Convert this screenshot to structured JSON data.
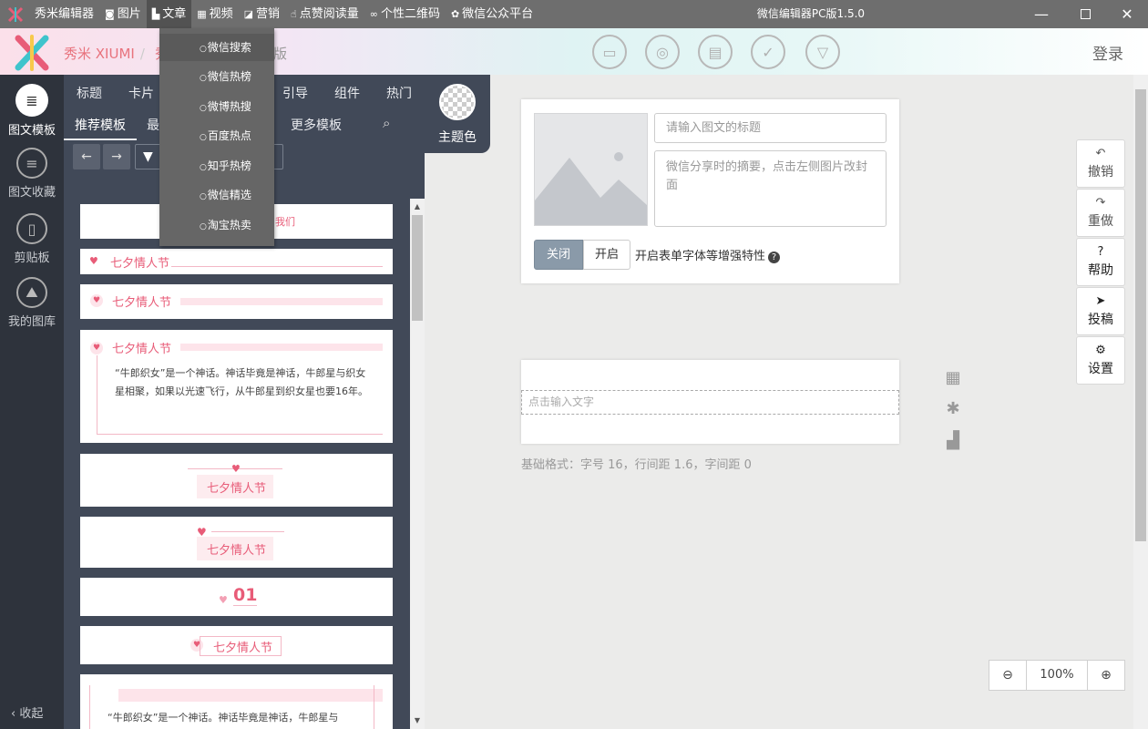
{
  "titlebar": {
    "menu": [
      {
        "label": "秀米编辑器",
        "icon": ""
      },
      {
        "label": "图片",
        "icon": "camera-icon"
      },
      {
        "label": "文章",
        "icon": "document-icon"
      },
      {
        "label": "视频",
        "icon": "film-icon"
      },
      {
        "label": "营销",
        "icon": "chart-icon"
      },
      {
        "label": "点赞阅读量",
        "icon": "thumb-icon"
      },
      {
        "label": "个性二维码",
        "icon": "link-icon"
      },
      {
        "label": "微信公众平台",
        "icon": "wechat-icon"
      }
    ],
    "app_title": "微信编辑器PC版1.5.0"
  },
  "dropdown": {
    "items": [
      "微信搜索",
      "微信热榜",
      "微博热搜",
      "百度热点",
      "知乎热榜",
      "微信精选",
      "淘宝热卖"
    ]
  },
  "header": {
    "brand": "秀米 XIUMI",
    "brand_sep": "/",
    "brand_tail_left": "秀",
    "brand_tail": "版",
    "login": "登录"
  },
  "leftbar": {
    "items": [
      "图文模板",
      "图文收藏",
      "剪贴板",
      "我的图库"
    ],
    "collapse": "收起"
  },
  "panel": {
    "tabs_row1": [
      "标题",
      "卡片",
      "引导",
      "组件",
      "热门"
    ],
    "tabs_row2": [
      "推荐模板",
      "最",
      "更多模板"
    ],
    "theme_label": "主题色"
  },
  "templates": {
    "top_text": "我们",
    "title": "七夕情人节",
    "body": "“牛郎织女”是一个神话。神话毕竟是神话，牛郎星与织女星相聚，如果以光速飞行，从牛郎星到织女星也要16年。",
    "body_bottom": "“牛郎织女”是一个神话。神话毕竟是神话，牛郎星与",
    "number": "01"
  },
  "editor": {
    "title_placeholder": "请输入图文的标题",
    "summary_placeholder": "微信分享时的摘要，点击左侧图片改封面",
    "toggle_off": "关闭",
    "toggle_on": "开启",
    "enhance_label": "开启表单字体等增强特性",
    "text_placeholder": "点击输入文字",
    "basic_format": "基础格式：字号 16，行间距 1.6，字间距 0"
  },
  "right_tools": [
    "撤销",
    "重做",
    "帮助",
    "投稿",
    "设置"
  ],
  "zoom": {
    "value": "100%"
  },
  "colors": {
    "brand_pink": "#e85c78",
    "panel_bg": "#414958",
    "sidebar_bg": "#2e333c",
    "titlebar_bg": "#6e6e6e"
  }
}
